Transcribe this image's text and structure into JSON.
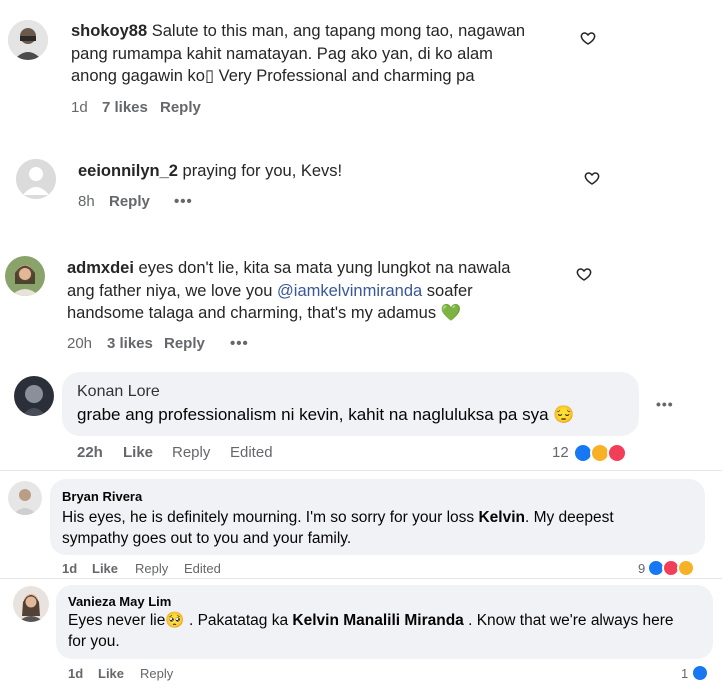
{
  "comments_ig": [
    {
      "username": "shokoy88",
      "text": "Salute to this man, ang tapang mong tao, nagawan pang rumampa kahit namatayan. Pag ako yan, di ko alam anong gagawin ko▯ Very Professional and charming pa",
      "line1": "Salute to this man, ang tapang mong tao, nagawan",
      "line2": "pang rumampa kahit namatayan. Pag ako yan, di ko alam",
      "line3": "anong gagawin ko▯ Very Professional and charming pa",
      "time": "1d",
      "likes": "7 likes",
      "reply": "Reply"
    },
    {
      "username": "eeionnilyn_2",
      "text": "praying for you, Kevs!",
      "time": "8h",
      "reply": "Reply",
      "more": "•••"
    },
    {
      "username": "admxdei",
      "line1": "eyes don't lie, kita sa mata yung lungkot na nawala",
      "line2a": "ang father niya, we love you ",
      "mention": "@iamkelvinmiranda",
      "line2b": " soafer",
      "line3": "handsome talaga and charming, that's my adamus",
      "emoji": "💚",
      "time": "20h",
      "likes": "3 likes",
      "reply": "Reply",
      "more": "•••"
    }
  ],
  "comments_fb": [
    {
      "name": "Konan Lore",
      "text": "grabe ang professionalism ni kevin, kahit na nagluluksa pa sya",
      "emoji": "😔",
      "time": "22h",
      "like": "Like",
      "reply": "Reply",
      "edited": "Edited",
      "reactions": "12",
      "more": "•••"
    },
    {
      "name": "Bryan Rivera",
      "line1a": "His eyes, he is definitely mourning. I'm so sorry for your loss ",
      "line1b": "Kelvin",
      "line1c": ". My deepest",
      "line2": "sympathy goes out to you and your family.",
      "time": "1d",
      "like": "Like",
      "reply": "Reply",
      "edited": "Edited",
      "reactions": "9"
    },
    {
      "name": "Vanieza May Lim",
      "line1a": "Eyes never lie",
      "emoji": "🥺",
      "line1b": " . Pakatatag ka ",
      "line1c": "Kelvin Manalili Miranda",
      "line1d": " . Know that we're always here",
      "line2": "for you.",
      "time": "1d",
      "like": "Like",
      "reply": "Reply",
      "reactions": "1"
    }
  ],
  "icons": {
    "heart": "heart-icon",
    "like": "like-reaction-icon",
    "sad": "sad-reaction-icon",
    "love": "love-reaction-icon",
    "care": "care-reaction-icon"
  }
}
